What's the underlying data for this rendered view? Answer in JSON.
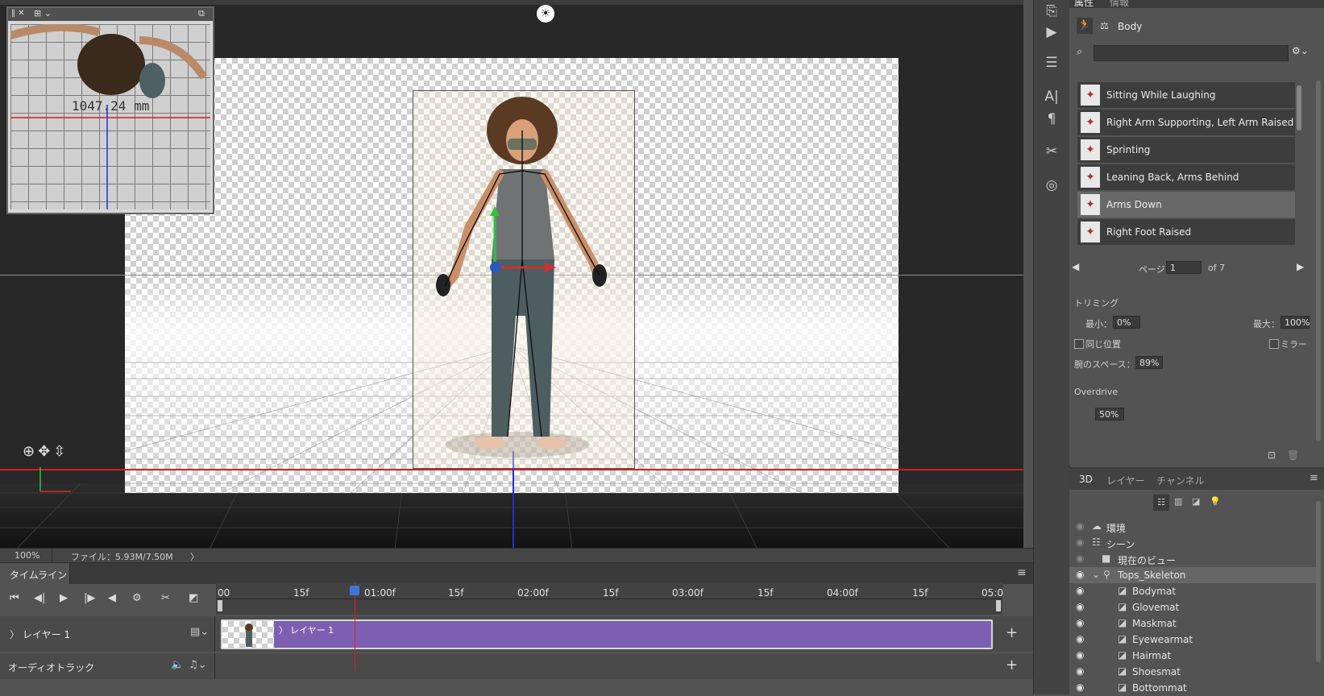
{
  "canvas": {
    "mode_icon": "light-bulb-icon",
    "navigator": {
      "measurement": "1047.24 mm"
    },
    "axis_widget_icons": [
      "orbit-icon",
      "pan-icon",
      "dolly-icon"
    ]
  },
  "statusbar": {
    "zoom": "100%",
    "file_info": "ファイル：5.93M/7.50M",
    "arrow": "〉"
  },
  "properties_panel": {
    "tabs": [
      "属性",
      "情報"
    ],
    "header_label": "Body",
    "search_placeholder": "",
    "poses": [
      {
        "label": "Sitting While Laughing",
        "selected": false
      },
      {
        "label": "Right Arm Supporting, Left Arm Raised",
        "selected": false
      },
      {
        "label": "Sprinting",
        "selected": false
      },
      {
        "label": "Leaning Back, Arms Behind",
        "selected": false
      },
      {
        "label": "Arms Down",
        "selected": true
      },
      {
        "label": "Right Foot Raised",
        "selected": false
      }
    ],
    "pager": {
      "page_label": "ページ",
      "page_value": "1",
      "of_label": "of 7"
    },
    "trimming": {
      "title": "トリミング",
      "min_label": "最小：",
      "min_value": "0%",
      "max_label": "最大：",
      "max_value": "100%",
      "same_position_label": "同じ位置",
      "mirror_label": "ミラー",
      "arm_space_label": "腕のスペース：",
      "arm_space_value": "89%"
    },
    "overdrive": {
      "title": "Overdrive",
      "value": "50%"
    }
  },
  "panel_3d": {
    "tabs": [
      "3D",
      "レイヤー",
      "チャンネル"
    ],
    "tree": [
      {
        "label": "環境",
        "indent": 0,
        "icon": "environment-icon"
      },
      {
        "label": "シーン",
        "indent": 0,
        "icon": "scene-icon"
      },
      {
        "label": "現在のビュー",
        "indent": 1,
        "icon": "camera-icon"
      },
      {
        "label": "Tops_Skeleton",
        "indent": 1,
        "icon": "skeleton-icon",
        "selected": true
      },
      {
        "label": "Bodymat",
        "indent": 2,
        "icon": "material-icon"
      },
      {
        "label": "Glovemat",
        "indent": 2,
        "icon": "material-icon"
      },
      {
        "label": "Maskmat",
        "indent": 2,
        "icon": "material-icon"
      },
      {
        "label": "Eyewearmat",
        "indent": 2,
        "icon": "material-icon"
      },
      {
        "label": "Hairmat",
        "indent": 2,
        "icon": "material-icon"
      },
      {
        "label": "Shoesmat",
        "indent": 2,
        "icon": "material-icon"
      },
      {
        "label": "Bottommat",
        "indent": 2,
        "icon": "material-icon"
      }
    ]
  },
  "timeline": {
    "tab_label": "タイムライン",
    "ticks": [
      "00",
      "15f",
      "01:00f",
      "15f",
      "02:00f",
      "15f",
      "03:00f",
      "15f",
      "04:00f",
      "15f",
      "05:0"
    ],
    "layer_track_label": "レイヤー 1",
    "clip_label": "レイヤー 1",
    "audio_track_label": "オーディオトラック"
  },
  "colors": {
    "clip_purple": "#7b5fb0",
    "playhead_red": "#e02020",
    "panel_bg": "#535353"
  }
}
